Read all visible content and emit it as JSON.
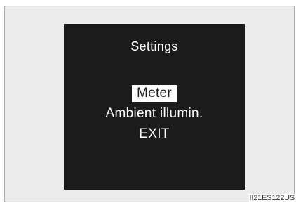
{
  "screen": {
    "title": "Settings",
    "menu": [
      {
        "label": "Meter",
        "selected": true
      },
      {
        "label": "Ambient illumin.",
        "selected": false
      },
      {
        "label": "EXIT",
        "selected": false
      }
    ]
  },
  "caption": "II21ES122US",
  "colors": {
    "screen_background": "#1b1b1b",
    "text": "#ffffff",
    "highlight": "#ffffff",
    "frame_background": "#ececec"
  }
}
